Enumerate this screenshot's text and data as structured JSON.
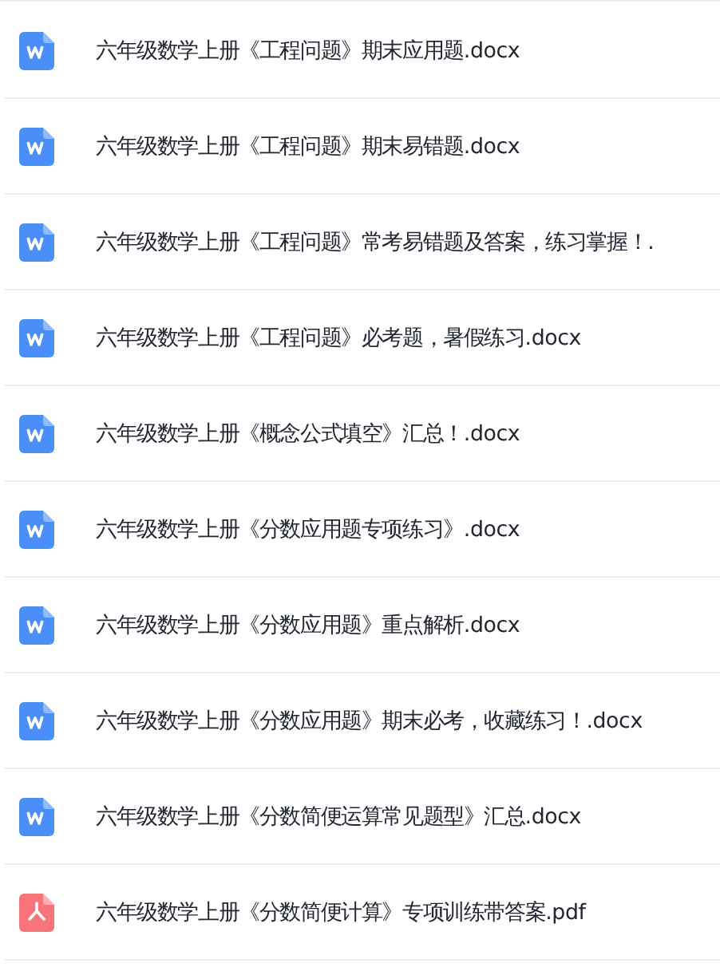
{
  "files": [
    {
      "name": "六年级数学上册《工程问题》期末应用题.docx",
      "kind": "docx"
    },
    {
      "name": "六年级数学上册《工程问题》期末易错题.docx",
      "kind": "docx"
    },
    {
      "name": "六年级数学上册《工程问题》常考易错题及答案，练习掌握！.",
      "kind": "docx"
    },
    {
      "name": "六年级数学上册《工程问题》必考题，暑假练习.docx",
      "kind": "docx"
    },
    {
      "name": "六年级数学上册《概念公式填空》汇总！.docx",
      "kind": "docx"
    },
    {
      "name": "六年级数学上册《分数应用题专项练习》.docx",
      "kind": "docx"
    },
    {
      "name": "六年级数学上册《分数应用题》重点解析.docx",
      "kind": "docx"
    },
    {
      "name": "六年级数学上册《分数应用题》期末必考，收藏练习！.docx",
      "kind": "docx"
    },
    {
      "name": "六年级数学上册《分数简便运算常见题型》汇总.docx",
      "kind": "docx"
    },
    {
      "name": "六年级数学上册《分数简便计算》专项训练带答案.pdf",
      "kind": "pdf"
    }
  ]
}
